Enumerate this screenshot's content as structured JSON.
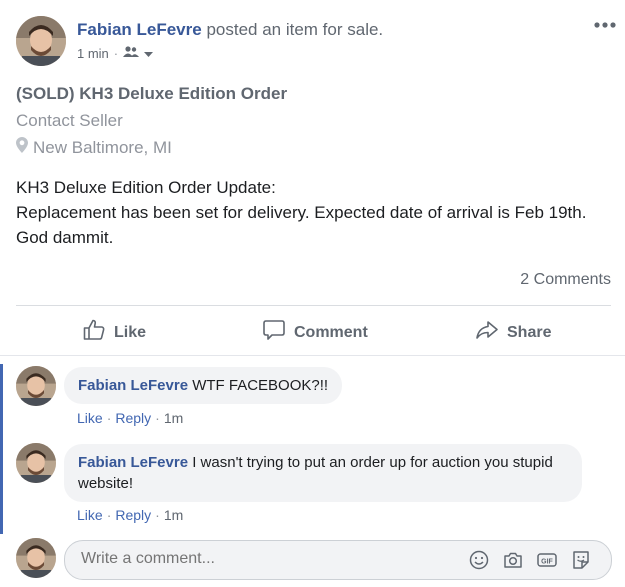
{
  "post": {
    "author": "Fabian LeFevre",
    "action_text": " posted an item for sale.",
    "time": "1 min",
    "dot": "·",
    "icons": {
      "audience": "friends-icon",
      "dropdown": "chevron-down-icon",
      "more": "more-options-icon"
    }
  },
  "listing": {
    "title": "(SOLD) KH3 Deluxe Edition Order",
    "contact": "Contact Seller",
    "location": "New Baltimore, MI",
    "location_icon": "location-pin-icon"
  },
  "body": {
    "lines": [
      "KH3 Deluxe Edition Order Update:",
      "Replacement has been set for delivery. Expected date of arrival is Feb 19th.",
      "God dammit."
    ]
  },
  "stats": {
    "comments": "2 Comments"
  },
  "actions": {
    "like": "Like",
    "comment": "Comment",
    "share": "Share"
  },
  "comments": [
    {
      "author": "Fabian LeFevre",
      "text": " WTF FACEBOOK?!!",
      "like": "Like",
      "reply": "Reply",
      "time": "1m"
    },
    {
      "author": "Fabian LeFevre",
      "text": " I wasn't trying to put an order up for auction you stupid website!",
      "like": "Like",
      "reply": "Reply",
      "time": "1m"
    }
  ],
  "composer": {
    "placeholder": "Write a comment...",
    "icons": [
      "emoji-icon",
      "camera-icon",
      "gif-icon",
      "sticker-icon"
    ]
  },
  "colors": {
    "link": "#385898",
    "accent": "#4267b2",
    "muted": "#606770",
    "bubble": "#f2f3f5"
  }
}
